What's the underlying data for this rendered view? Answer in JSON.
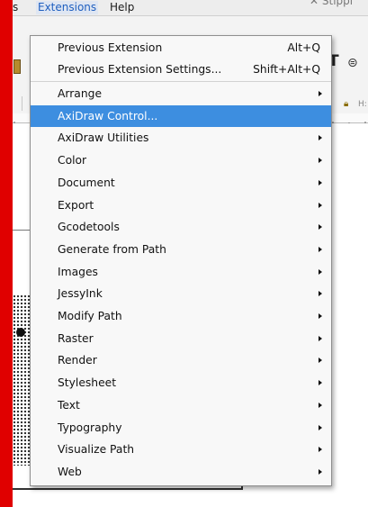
{
  "menubar": {
    "prev_menu_fragment": "s",
    "extensions": "Extensions",
    "help": "Help"
  },
  "window_title_fragment": "Stippl",
  "extensions_menu": {
    "items": [
      {
        "label": "Previous Extension",
        "accel": "Alt+Q"
      },
      {
        "label": "Previous Extension Settings...",
        "accel": "Shift+Alt+Q"
      },
      {
        "label": "Arrange",
        "submenu": true
      },
      {
        "label": "AxiDraw Control...",
        "selected": true
      },
      {
        "label": "AxiDraw Utilities",
        "submenu": true
      },
      {
        "label": "Color",
        "submenu": true
      },
      {
        "label": "Document",
        "submenu": true
      },
      {
        "label": "Export",
        "submenu": true
      },
      {
        "label": "Gcodetools",
        "submenu": true
      },
      {
        "label": "Generate from Path",
        "submenu": true
      },
      {
        "label": "Images",
        "submenu": true
      },
      {
        "label": "JessyInk",
        "submenu": true
      },
      {
        "label": "Modify Path",
        "submenu": true
      },
      {
        "label": "Raster",
        "submenu": true
      },
      {
        "label": "Render",
        "submenu": true
      },
      {
        "label": "Stylesheet",
        "submenu": true
      },
      {
        "label": "Text",
        "submenu": true
      },
      {
        "label": "Typography",
        "submenu": true
      },
      {
        "label": "Visualize Path",
        "submenu": true
      },
      {
        "label": "Web",
        "submenu": true
      }
    ]
  },
  "toolbar": {
    "h_label": "H:"
  },
  "colors": {
    "selection": "#3d8ee0",
    "frame": "#e00000"
  },
  "icons": [
    "tool-icon",
    "text-tool-icon",
    "list-icon",
    "lock-icon",
    "submenu-arrow-icon"
  ]
}
